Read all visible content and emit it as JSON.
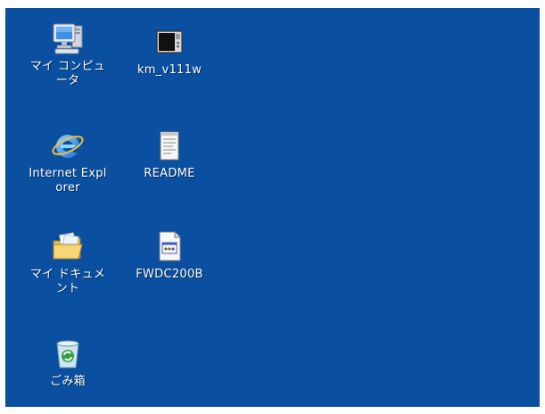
{
  "desktop": {
    "background_color": "#0a4fa0",
    "icons": [
      {
        "label": "マイ コンピュータ",
        "icon": "my-computer-icon"
      },
      {
        "label": "km_v111w",
        "icon": "application-window-icon"
      },
      {
        "label": "Internet Explorer",
        "icon": "internet-explorer-icon"
      },
      {
        "label": "README",
        "icon": "text-document-icon"
      },
      {
        "label": "マイ ドキュメント",
        "icon": "my-documents-folder-icon"
      },
      {
        "label": "FWDC200B",
        "icon": "image-file-icon"
      },
      {
        "label": "ごみ箱",
        "icon": "recycle-bin-icon"
      }
    ]
  }
}
